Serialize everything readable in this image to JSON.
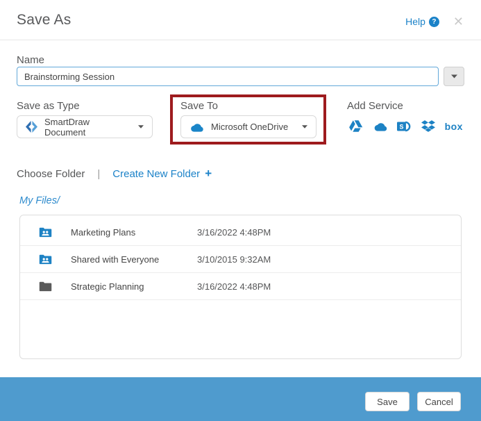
{
  "header": {
    "title": "Save As",
    "help_label": "Help",
    "help_icon": "?",
    "close_icon": "✕"
  },
  "name_section": {
    "label": "Name",
    "value": "Brainstorming Session"
  },
  "type_section": {
    "label": "Save as Type",
    "selected": "SmartDraw Document",
    "icon": "smartdraw-logo"
  },
  "save_to_section": {
    "label": "Save To",
    "selected": "Microsoft OneDrive",
    "icon": "onedrive-cloud",
    "highlight_color": "#9e1b1e"
  },
  "add_service_section": {
    "label": "Add Service",
    "services": [
      {
        "name": "Google Drive"
      },
      {
        "name": "Microsoft OneDrive"
      },
      {
        "name": "SharePoint",
        "letter": "S"
      },
      {
        "name": "Dropbox"
      },
      {
        "name": "Box",
        "logo_text": "box"
      }
    ]
  },
  "folder_bar": {
    "choose_label": "Choose Folder",
    "divider": "|",
    "create_label": "Create New Folder",
    "plus": "+"
  },
  "breadcrumb": {
    "path": "My Files/"
  },
  "file_list": [
    {
      "name": "Marketing Plans",
      "modified": "3/16/2022 4:48PM",
      "icon": "shared-folder"
    },
    {
      "name": "Shared with Everyone",
      "modified": "3/10/2015 9:32AM",
      "icon": "shared-folder"
    },
    {
      "name": "Strategic Planning",
      "modified": "3/16/2022 4:48PM",
      "icon": "folder"
    }
  ],
  "footer": {
    "save_label": "Save",
    "cancel_label": "Cancel",
    "bar_color": "#4f9bce"
  },
  "colors": {
    "link_blue": "#1b82c8",
    "icon_blue": "#1d82c4",
    "highlight_red": "#9e1b1e",
    "footer_blue": "#4f9bce",
    "input_border_blue": "#62a8d9"
  }
}
